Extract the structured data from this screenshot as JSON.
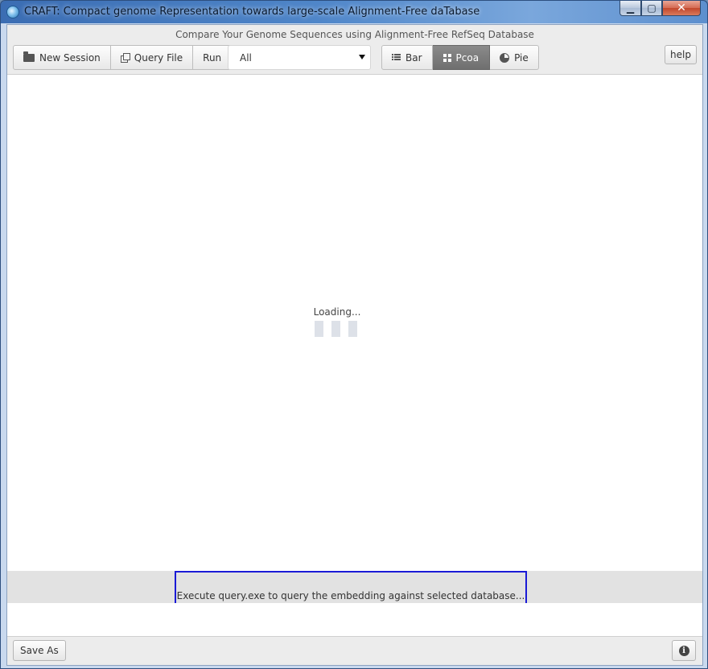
{
  "window": {
    "title": "CRAFT: Compact genome Representation towards large-scale Alignment-Free daTabase",
    "controls": {
      "minimize": "▁",
      "maximize": "▢",
      "close": "✕"
    }
  },
  "header": {
    "subtitle": "Compare Your Genome Sequences using Alignment-Free RefSeq Database"
  },
  "toolbar": {
    "new_session_label": "New Session",
    "query_file_label": "Query File",
    "run_label": "Run",
    "database_select": {
      "selected": "All"
    },
    "view_tabs": [
      {
        "label": "Bar",
        "icon": "list-icon",
        "active": false
      },
      {
        "label": "Pcoa",
        "icon": "grid-icon",
        "active": true
      },
      {
        "label": "Pie",
        "icon": "pie-icon",
        "active": false
      }
    ],
    "help_label": "help"
  },
  "main": {
    "loading_text": "Loading..."
  },
  "status": {
    "message": "Execute query.exe to query the embedding against selected database..."
  },
  "footer": {
    "save_as_label": "Save As",
    "info_icon": "i"
  },
  "colors": {
    "active_tab": "#7a7a7a",
    "highlight_border": "#1a1ad6",
    "status_strip": "#e2e2e2"
  }
}
